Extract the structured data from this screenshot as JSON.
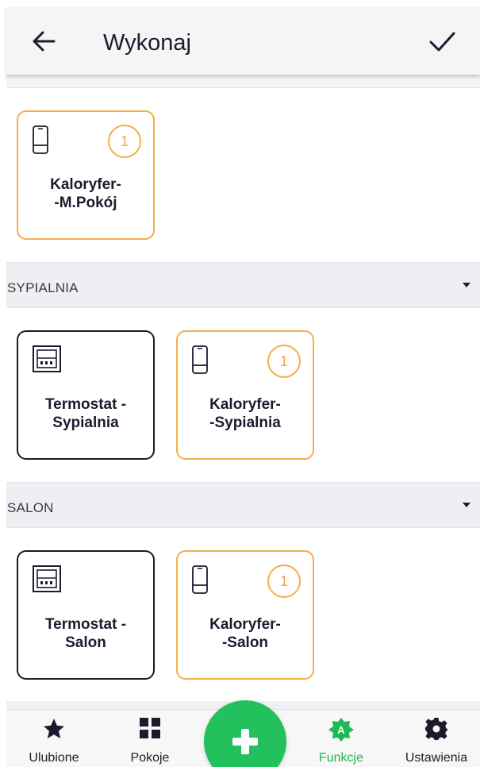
{
  "header": {
    "title": "Wykonaj",
    "back_icon": "arrow-left-icon",
    "confirm_icon": "check-icon"
  },
  "top_group": {
    "devices": [
      {
        "name": "Kaloryfer-\n-M.Pokój",
        "icon": "radiator-valve-icon",
        "badge": "1",
        "highlight": "orange"
      }
    ]
  },
  "sections": [
    {
      "label": "SYPIALNIA",
      "devices": [
        {
          "name": "Termostat -\nSypialnia",
          "icon": "thermostat-icon",
          "highlight": "black"
        },
        {
          "name": "Kaloryfer-\n-Sypialnia",
          "icon": "radiator-valve-icon",
          "badge": "1",
          "highlight": "orange"
        }
      ]
    },
    {
      "label": "SALON",
      "devices": [
        {
          "name": "Termostat -\nSalon",
          "icon": "thermostat-icon",
          "highlight": "black"
        },
        {
          "name": "Kaloryfer-\n-Salon",
          "icon": "radiator-valve-icon",
          "badge": "1",
          "highlight": "orange"
        }
      ]
    }
  ],
  "bottom_nav": {
    "items": [
      {
        "label": "Ulubione",
        "icon": "star-icon"
      },
      {
        "label": "Pokoje",
        "icon": "grid-icon"
      },
      {
        "label": "Funkcje",
        "icon": "automation-icon",
        "active": true
      },
      {
        "label": "Ustawienia",
        "icon": "gear-icon"
      }
    ],
    "fab_icon": "plus-icon"
  },
  "colors": {
    "accent_green": "#22c15e",
    "highlight_orange": "#f2b04a",
    "border_black": "#1b1b22"
  }
}
